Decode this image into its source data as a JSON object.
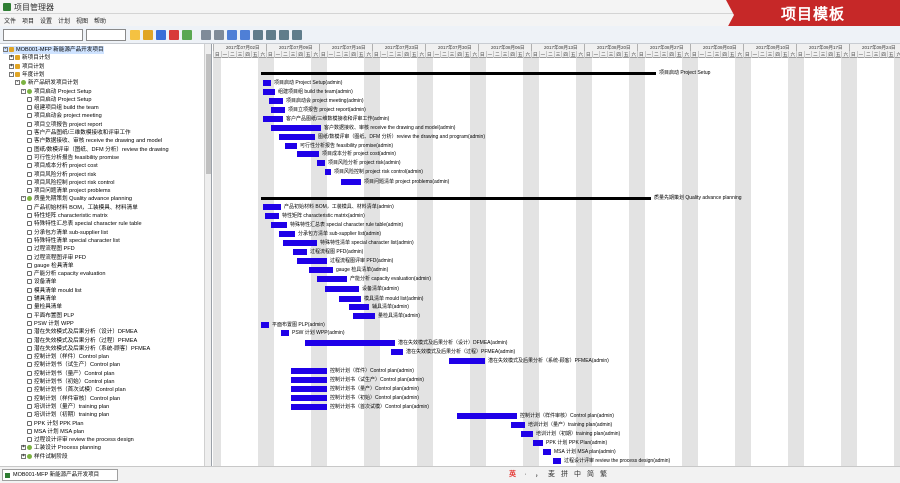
{
  "app": {
    "title": "项目管理器"
  },
  "menu": [
    "文件",
    "项目",
    "设置",
    "计划",
    "视图",
    "帮助"
  ],
  "banner": {
    "text": "项目模板"
  },
  "toolbar": {
    "project_value": "",
    "search_value": "",
    "buttons": [
      {
        "name": "new-icon",
        "color": "#f5c242"
      },
      {
        "name": "open-icon",
        "color": "#e0a526"
      },
      {
        "name": "save-icon",
        "color": "#3a6fd8"
      },
      {
        "name": "delete-icon",
        "color": "#d83a3a"
      },
      {
        "name": "add-task-icon",
        "color": "#5aa852"
      },
      {
        "name": "indent-icon",
        "color": "#7f8b99"
      },
      {
        "name": "outdent-icon",
        "color": "#7f8b99"
      },
      {
        "name": "link-icon",
        "color": "#4f7fd6"
      },
      {
        "name": "unlink-icon",
        "color": "#4f7fd6"
      },
      {
        "name": "zoom-in-icon",
        "color": "#607d8b"
      },
      {
        "name": "zoom-out-icon",
        "color": "#607d8b"
      },
      {
        "name": "find-icon",
        "color": "#607d8b"
      },
      {
        "name": "scroll-to-task-icon",
        "color": "#607d8b"
      }
    ]
  },
  "tree": {
    "items": [
      {
        "level": 0,
        "icon": "folder",
        "label": "MOB001-MFP 新能源产品开发项目",
        "selected": true,
        "exp": "-"
      },
      {
        "level": 1,
        "icon": "folder",
        "label": "新项目计划",
        "exp": "+"
      },
      {
        "level": 1,
        "icon": "folder",
        "label": "项目计划",
        "exp": "+"
      },
      {
        "level": 1,
        "icon": "folder",
        "label": "年度计划",
        "exp": "-"
      },
      {
        "level": 2,
        "icon": "phase",
        "label": "新产品研发项目计划",
        "exp": "-"
      },
      {
        "level": 3,
        "icon": "phase",
        "label": "项目启动 Project Setup",
        "exp": "-"
      },
      {
        "level": 4,
        "icon": "task",
        "label": "项目启动 Project Setup"
      },
      {
        "level": 4,
        "icon": "task",
        "label": "组建项目组 build the team"
      },
      {
        "level": 4,
        "icon": "task",
        "label": "项目启动会 project meeting"
      },
      {
        "level": 4,
        "icon": "task",
        "label": "项目立项报告 project report"
      },
      {
        "level": 4,
        "icon": "task",
        "label": "客户产品图纸/三维数模接收和评审工作"
      },
      {
        "level": 4,
        "icon": "task",
        "label": "客户数据接收、审核 receive the drawing and model"
      },
      {
        "level": 4,
        "icon": "task",
        "label": "图纸/数模评审（图纸、DFM 分析）review the drawing"
      },
      {
        "level": 4,
        "icon": "task",
        "label": "可行性分析报告 feasibility promise"
      },
      {
        "level": 4,
        "icon": "task",
        "label": "项目成本分析 project cost"
      },
      {
        "level": 4,
        "icon": "task",
        "label": "项目风险分析 project risk"
      },
      {
        "level": 4,
        "icon": "task",
        "label": "项目风险控制 project risk control"
      },
      {
        "level": 4,
        "icon": "task",
        "label": "项目问题清单 project problems"
      },
      {
        "level": 3,
        "icon": "phase",
        "label": "质量先期策划 Quality advance planning",
        "exp": "-"
      },
      {
        "level": 4,
        "icon": "task",
        "label": "产品初始材料 BOM，工装模具、材料清单"
      },
      {
        "level": 4,
        "icon": "task",
        "label": "特性矩阵 characteristic matrix"
      },
      {
        "level": 4,
        "icon": "task",
        "label": "特殊特性汇总表 special character rule table"
      },
      {
        "level": 4,
        "icon": "task",
        "label": "分承包方清单 sub-supplier list"
      },
      {
        "level": 4,
        "icon": "task",
        "label": "特殊特性清单 special character list"
      },
      {
        "level": 4,
        "icon": "task",
        "label": "过程流程图 PFD"
      },
      {
        "level": 4,
        "icon": "task",
        "label": "过程流程图评审 PFD"
      },
      {
        "level": 4,
        "icon": "task",
        "label": "gauge 检具清单"
      },
      {
        "level": 4,
        "icon": "task",
        "label": "产能分析 capacity evaluation"
      },
      {
        "level": 4,
        "icon": "task",
        "label": "设备清单"
      },
      {
        "level": 4,
        "icon": "task",
        "label": "模具清单 mould list"
      },
      {
        "level": 4,
        "icon": "task",
        "label": "辅具清单"
      },
      {
        "level": 4,
        "icon": "task",
        "label": "量检具清单"
      },
      {
        "level": 4,
        "icon": "task",
        "label": "平面布置图 PLP"
      },
      {
        "level": 4,
        "icon": "task",
        "label": "PSW 计划 WPP"
      },
      {
        "level": 4,
        "icon": "task",
        "label": "潜在失效模式及后果分析（设计）DFMEA"
      },
      {
        "level": 4,
        "icon": "task",
        "label": "潜在失效模式及后果分析（过程）PFMEA"
      },
      {
        "level": 4,
        "icon": "task",
        "label": "潜在失效模式及后果分析（系统-顾客）PFMEA"
      },
      {
        "level": 4,
        "icon": "task",
        "label": "控制计划（样件）Control plan"
      },
      {
        "level": 4,
        "icon": "task",
        "label": "控制计划书（试生产）Control plan"
      },
      {
        "level": 4,
        "icon": "task",
        "label": "控制计划书（量产）Control plan"
      },
      {
        "level": 4,
        "icon": "task",
        "label": "控制计划书（初始）Control plan"
      },
      {
        "level": 4,
        "icon": "task",
        "label": "控制计划书（首次试模）Control plan"
      },
      {
        "level": 4,
        "icon": "task",
        "label": "控制计划（样件审核）Control plan"
      },
      {
        "level": 4,
        "icon": "task",
        "label": "培训计划（量产）training plan"
      },
      {
        "level": 4,
        "icon": "task",
        "label": "培训计划（初期）training plan"
      },
      {
        "level": 4,
        "icon": "task",
        "label": "PPK 计划 PPK Plan"
      },
      {
        "level": 4,
        "icon": "task",
        "label": "MSA 计划 MSA plan"
      },
      {
        "level": 4,
        "icon": "task",
        "label": "过程设计评审 review the process design"
      },
      {
        "level": 3,
        "icon": "phase",
        "label": "工装设计 Process planning",
        "exp": "+"
      },
      {
        "level": 3,
        "icon": "phase",
        "label": "样件试制阶段",
        "exp": "+"
      }
    ]
  },
  "timeline": {
    "weeks": [
      "2017年07月02日",
      "2017年07月09日",
      "2017年07月16日",
      "2017年07月23日",
      "2017年07月30日",
      "2017年08月06日",
      "2017年08月13日",
      "2017年08月20日",
      "2017年08月27日",
      "2017年09月03日",
      "2017年09月10日",
      "2017年09月17日",
      "2017年09月24日"
    ],
    "day_labels": [
      "日",
      "一",
      "二",
      "三",
      "四",
      "五",
      "六"
    ]
  },
  "gantt": {
    "tasks": [
      {
        "kind": "summary",
        "label": "项目启动 Project Setup"
      },
      {
        "label": "项目启动 Project Setup(admin)"
      },
      {
        "label": "组建项目组 build the team(admin)"
      },
      {
        "label": "项目启动会 project meeting(admin)"
      },
      {
        "label": "项目立项报告 project report(admin)"
      },
      {
        "label": "客户产品图纸/三维数模接收和评审工作(admin)"
      },
      {
        "label": "客户数据接收、审核 receive the drawing and model(admin)"
      },
      {
        "label": "图纸/数模评审（图纸、DFM 分析）review the drawing and program(admin)"
      },
      {
        "label": "可行性分析报告 feasibility promise(admin)"
      },
      {
        "label": "项目成本分析 project cost(admin)"
      },
      {
        "label": "项目风险分析 project risk(admin)"
      },
      {
        "label": "项目风险控制 project risk control(admin)"
      },
      {
        "label": "项目问题清单 project problems(admin)"
      },
      {
        "kind": "summary",
        "label": "质量先期策划 Quality advance planning"
      },
      {
        "label": "产品初始材料 BOM，工装模具、材料清单(admin)"
      },
      {
        "label": "特性矩阵 characteristic matrix(admin)"
      },
      {
        "label": "特殊特性汇总表 special character rule table(admin)"
      },
      {
        "label": "分承包方清单 sub-supplier list(admin)"
      },
      {
        "label": "特殊特性清单 special character list(admin)"
      },
      {
        "label": "过程流程图 PFD(admin)"
      },
      {
        "label": "过程流程图评审 PFD(admin)"
      },
      {
        "label": "gauge 检具清单(admin)"
      },
      {
        "label": "产能分析 capacity evaluation(admin)"
      },
      {
        "label": "设备清单(admin)"
      },
      {
        "label": "模具清单 mould list(admin)"
      },
      {
        "label": "辅具清单(admin)"
      },
      {
        "label": "量检具清单(admin)"
      },
      {
        "label": "平面布置图 PLP(admin)"
      },
      {
        "label": "PSW 计划 WPP(admin)"
      },
      {
        "label": "潜在失效模式及后果分析（设计）DFMEA(admin)"
      },
      {
        "label": "潜在失效模式及后果分析（过程）PFMEA(admin)"
      },
      {
        "label": "潜在失效模式及后果分析（系统-顾客）PFMEA(admin)"
      },
      {
        "label": "控制计划（样件）Control plan(admin)"
      },
      {
        "label": "控制计划书（试生产）Control plan(admin)"
      },
      {
        "label": "控制计划书（量产）Control plan(admin)"
      },
      {
        "label": "控制计划书（初始）Control plan(admin)"
      },
      {
        "label": "控制计划书（首次试模）Control plan(admin)"
      },
      {
        "label": "控制计划（样件审核）Control plan(admin)"
      },
      {
        "label": "培训计划（量产）training plan(admin)"
      },
      {
        "label": "培训计划（初期）training plan(admin)"
      },
      {
        "label": "PPK 计划 PPK Plan(admin)"
      },
      {
        "label": "MSA 计划 MSA plan(admin)"
      },
      {
        "label": "过程设计评审 review the process design(admin)"
      }
    ]
  },
  "statusbar": {
    "tab_label": "MOB001-MFP 新能源产品开发项目",
    "ime": [
      "英",
      "·",
      "，",
      "麦",
      "拼",
      "中",
      "简",
      "繁"
    ]
  },
  "colors": {
    "bar": "#1f00e8",
    "summary": "#000000",
    "banner": "#c62828",
    "weekend": "#e3e3e3"
  }
}
